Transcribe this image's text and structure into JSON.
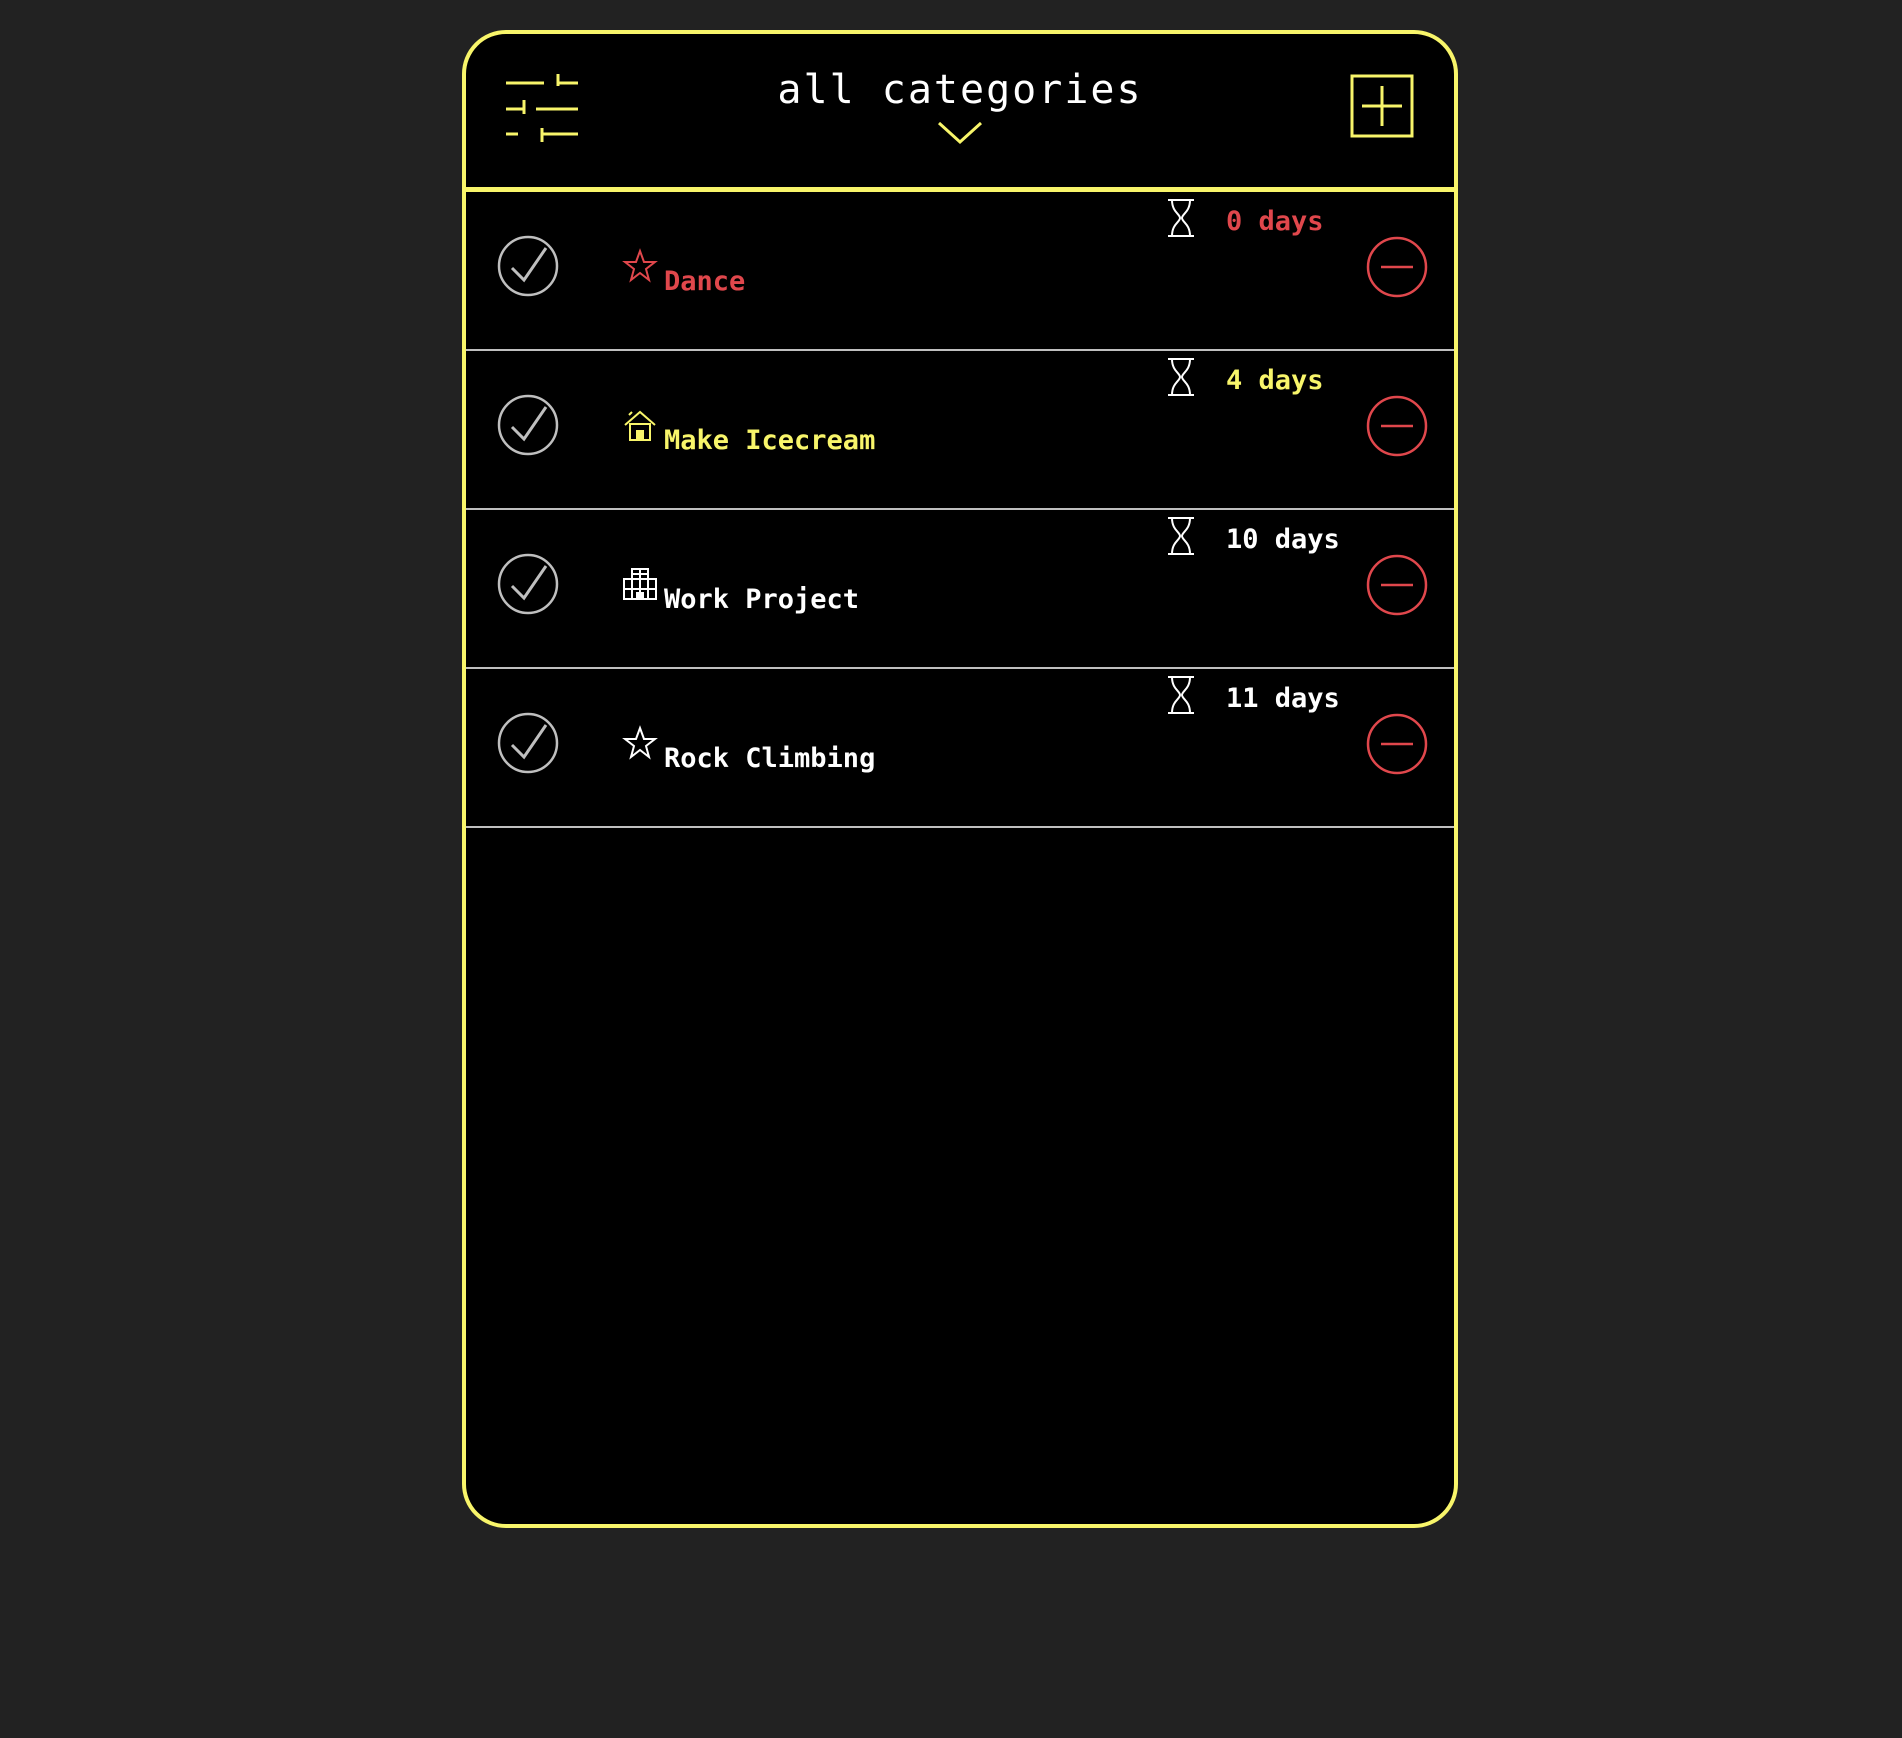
{
  "colors": {
    "accent": "#f8f56a",
    "danger": "#e0474c",
    "text": "#ffffff",
    "muted": "#bfbfbf",
    "page_background": "#222222",
    "panel_background": "#000000"
  },
  "header": {
    "filter_icon": "sliders-icon",
    "title": "all categories",
    "dropdown_icon": "chevron-down-icon",
    "add_icon": "plus-square-icon"
  },
  "tasks": [
    {
      "name": "Dance",
      "category_icon": "star-icon",
      "days": "0 days",
      "color": "#e0474c",
      "check_icon": "check-circle-icon",
      "timer_icon": "hourglass-icon",
      "remove_icon": "minus-circle-icon"
    },
    {
      "name": "Make Icecream",
      "category_icon": "house-icon",
      "days": "4 days",
      "color": "#f8f56a",
      "check_icon": "check-circle-icon",
      "timer_icon": "hourglass-icon",
      "remove_icon": "minus-circle-icon"
    },
    {
      "name": "Work Project",
      "category_icon": "office-building-icon",
      "days": "10 days",
      "color": "#ffffff",
      "check_icon": "check-circle-icon",
      "timer_icon": "hourglass-icon",
      "remove_icon": "minus-circle-icon"
    },
    {
      "name": "Rock Climbing",
      "category_icon": "star-icon",
      "days": "11 days",
      "color": "#ffffff",
      "check_icon": "check-circle-icon",
      "timer_icon": "hourglass-icon",
      "remove_icon": "minus-circle-icon"
    }
  ]
}
